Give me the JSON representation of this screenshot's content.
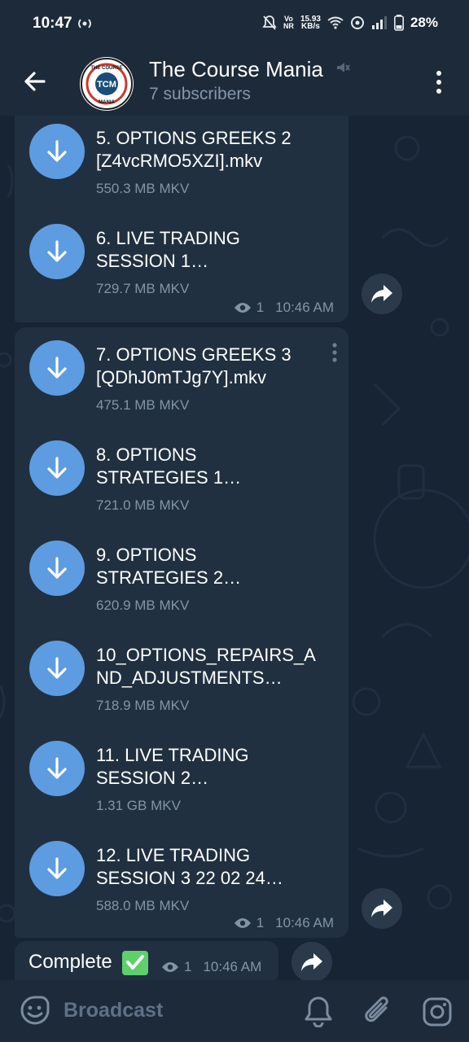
{
  "status_bar": {
    "time": "10:47",
    "hotspot": "(·)",
    "volte": "Vo\nNR",
    "net_speed": "15.93\nKB/s",
    "battery": "28%"
  },
  "header": {
    "title": "The Course Mania",
    "subtitle": "7 subscribers",
    "avatar_text": "TCM",
    "avatar_top": "THE COURSE",
    "avatar_bottom": "MANIA"
  },
  "bubble1": {
    "files": [
      {
        "name": "5. OPTIONS GREEKS 2\n[Z4vcRMO5XZI].mkv",
        "meta": "550.3 MB MKV"
      },
      {
        "name": "6. LIVE TRADING\nSESSION  1…",
        "meta": "729.7 MB MKV"
      }
    ],
    "views": "1",
    "time": "10:46 AM"
  },
  "bubble2": {
    "files": [
      {
        "name": "7. OPTIONS GREEKS 3\n[QDhJ0mTJg7Y].mkv",
        "meta": "475.1 MB MKV"
      },
      {
        "name": "8. OPTIONS\nSTRATEGIES 1…",
        "meta": "721.0 MB MKV"
      },
      {
        "name": "9. OPTIONS\nSTRATEGIES 2…",
        "meta": "620.9 MB MKV"
      },
      {
        "name": "10_OPTIONS_REPAIRS_A\nND_ADJUSTMENTS…",
        "meta": "718.9 MB MKV"
      },
      {
        "name": "11. LIVE TRADING\nSESSION 2…",
        "meta": "1.31 GB MKV"
      },
      {
        "name": "12. LIVE TRADING\nSESSION 3 22 02 24…",
        "meta": "588.0 MB MKV"
      }
    ],
    "views": "1",
    "time": "10:46 AM"
  },
  "complete_msg": {
    "text": "Complete",
    "views": "1",
    "time": "10:46 AM"
  },
  "bottom_bar": {
    "label": "Broadcast"
  },
  "colors": {
    "accent": "#5d9ce0",
    "bubble": "#203040",
    "header": "#1d2a39",
    "check": "#5fcf6c"
  },
  "icons": [
    "back-arrow-icon",
    "mute-icon",
    "menu-dots-icon",
    "download-icon",
    "eye-icon",
    "forward-icon",
    "check-icon",
    "emoji-icon",
    "bell-icon",
    "paperclip-icon",
    "instagram-icon"
  ]
}
